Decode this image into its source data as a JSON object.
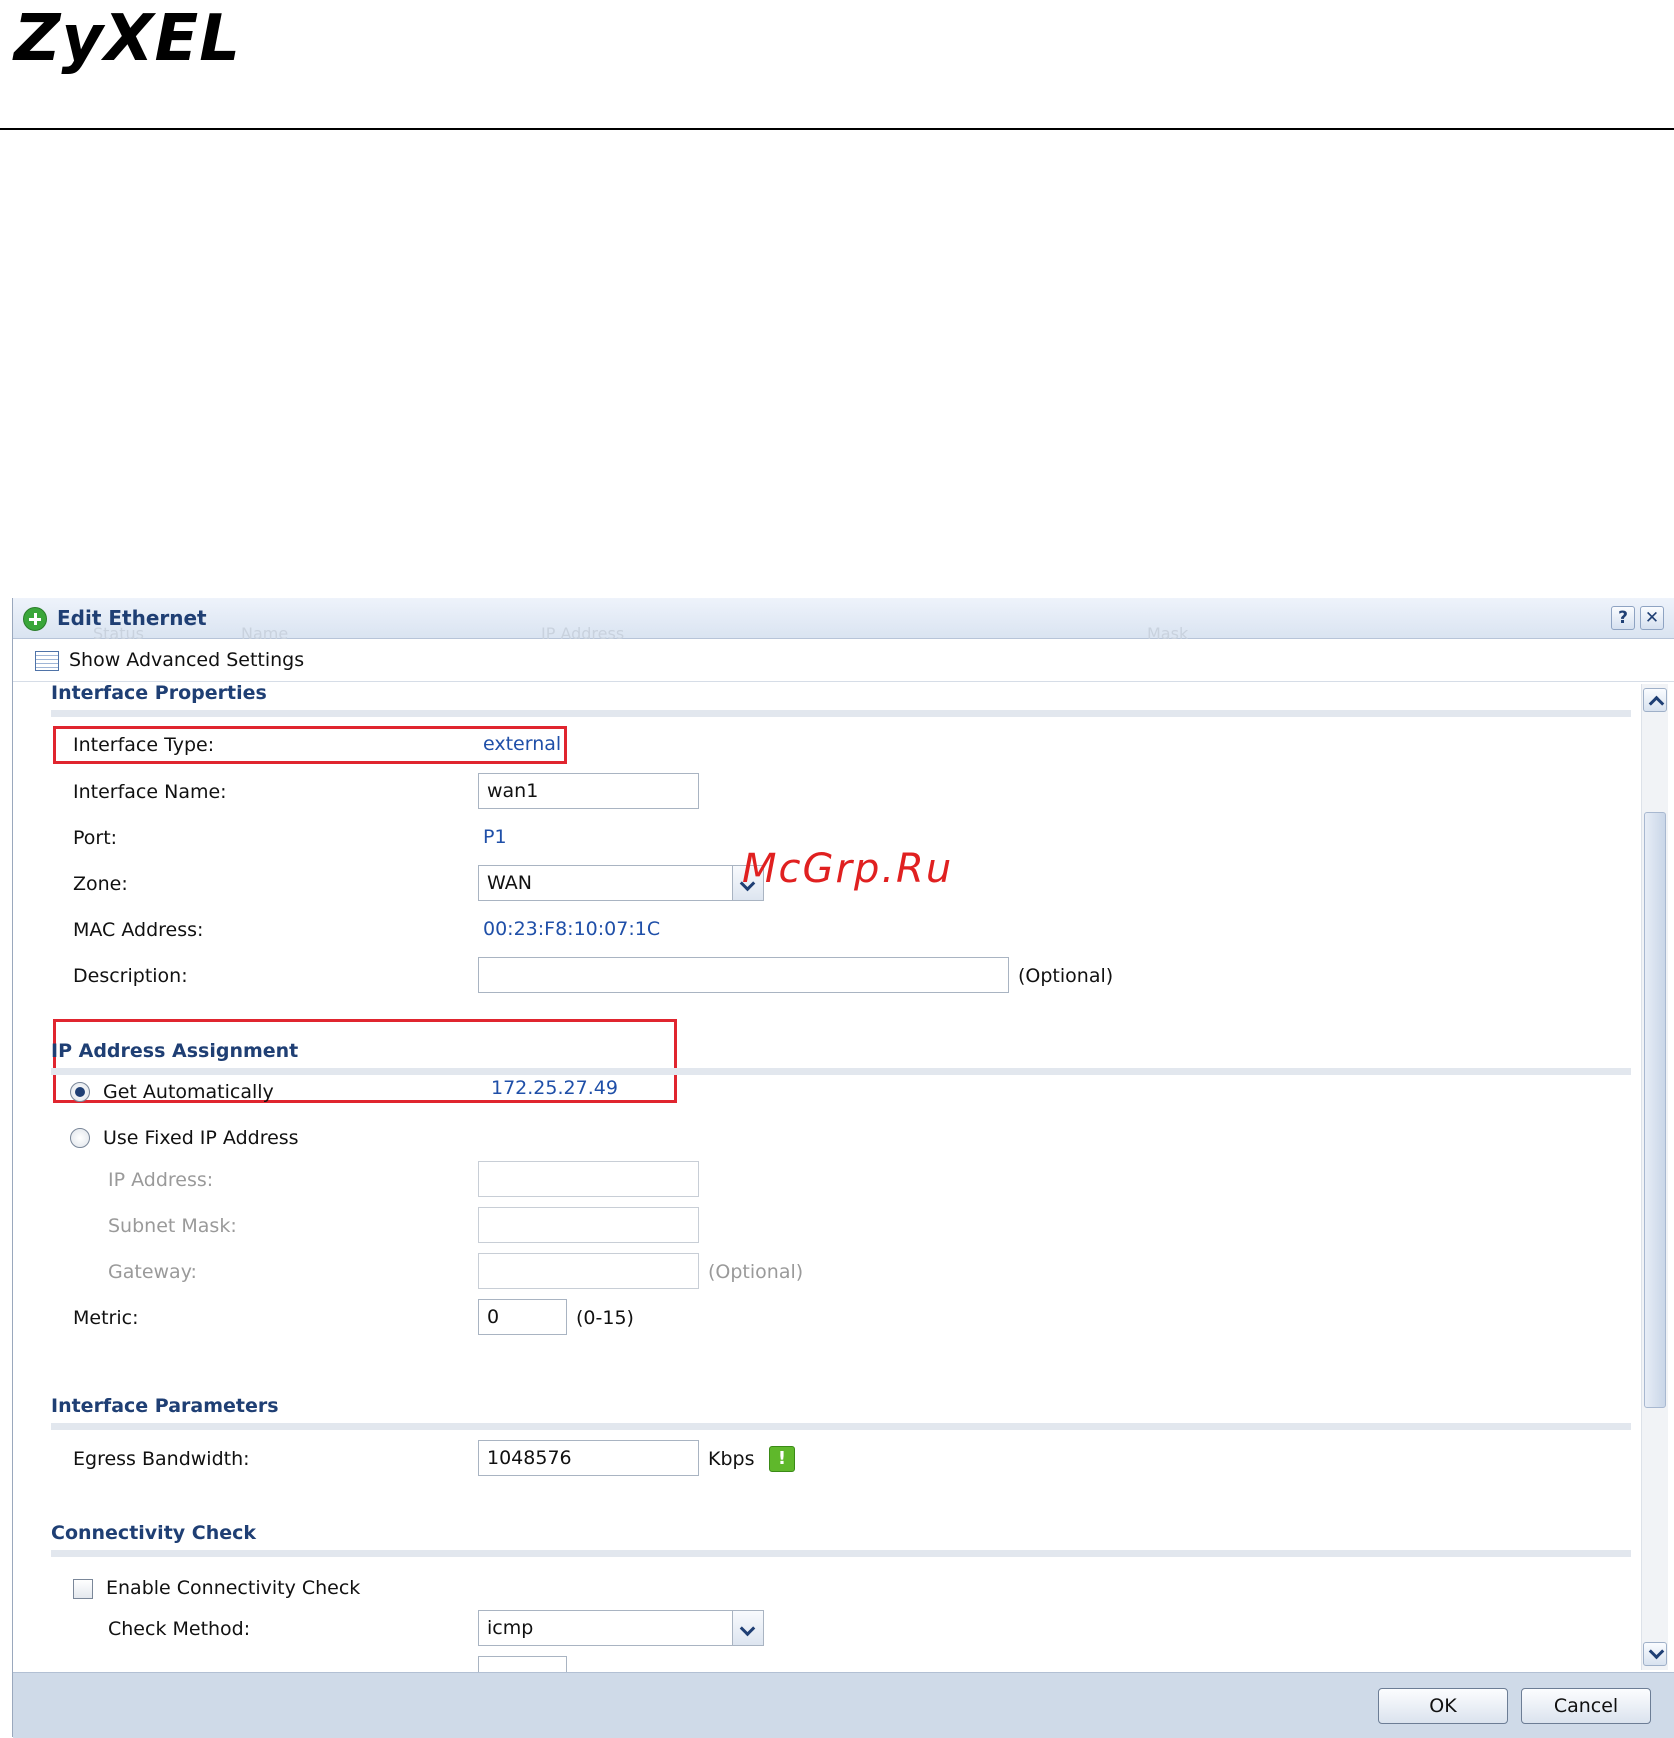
{
  "logo": "ZyXEL",
  "watermark": "McGrp.Ru",
  "dialog": {
    "title": "Edit Ethernet",
    "help_label": "?",
    "close_label": "✕",
    "background_columns": [
      "Status",
      "Name",
      "IP Address",
      "Mask"
    ],
    "toolbar": {
      "advanced_label": "Show Advanced Settings"
    },
    "interface_properties": {
      "heading": "Interface Properties",
      "type_label": "Interface Type:",
      "type_value": "external",
      "name_label": "Interface Name:",
      "name_value": "wan1",
      "port_label": "Port:",
      "port_value": "P1",
      "zone_label": "Zone:",
      "zone_value": "WAN",
      "mac_label": "MAC Address:",
      "mac_value": "00:23:F8:10:07:1C",
      "description_label": "Description:",
      "description_value": "",
      "description_hint": "(Optional)"
    },
    "ip_assignment": {
      "heading": "IP Address Assignment",
      "auto_label": "Get Automatically",
      "auto_value": "172.25.27.49",
      "auto_selected": true,
      "fixed_label": "Use Fixed IP Address",
      "ip_label": "IP Address:",
      "ip_value": "",
      "mask_label": "Subnet Mask:",
      "mask_value": "",
      "gateway_label": "Gateway:",
      "gateway_value": "",
      "gateway_hint": "(Optional)",
      "metric_label": "Metric:",
      "metric_value": "0",
      "metric_hint": "(0-15)"
    },
    "interface_parameters": {
      "heading": "Interface Parameters",
      "egress_label": "Egress Bandwidth:",
      "egress_value": "1048576",
      "egress_unit": "Kbps",
      "warning_glyph": "!"
    },
    "connectivity": {
      "heading": "Connectivity Check",
      "enable_label": "Enable Connectivity Check",
      "enable_checked": false,
      "method_label": "Check Method:",
      "method_value": "icmp"
    },
    "footer": {
      "ok_label": "OK",
      "cancel_label": "Cancel"
    }
  }
}
